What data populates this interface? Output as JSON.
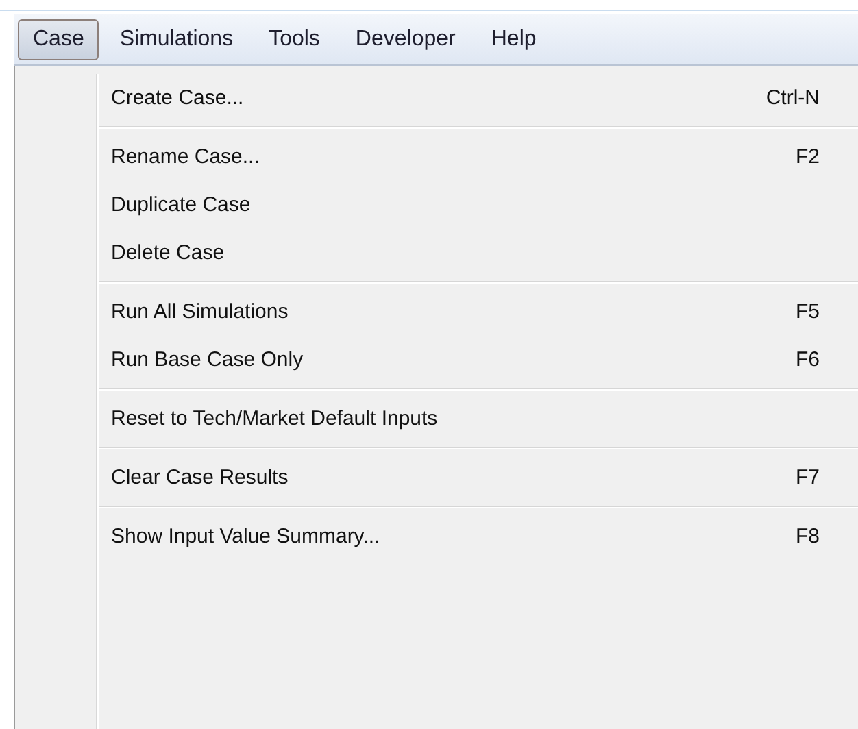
{
  "menubar": [
    {
      "label": "Case",
      "selected": true
    },
    {
      "label": "Simulations",
      "selected": false
    },
    {
      "label": "Tools",
      "selected": false
    },
    {
      "label": "Developer",
      "selected": false
    },
    {
      "label": "Help",
      "selected": false
    }
  ],
  "menu": {
    "groups": [
      [
        {
          "label": "Create Case...",
          "shortcut": "Ctrl-N"
        }
      ],
      [
        {
          "label": "Rename Case...",
          "shortcut": "F2"
        },
        {
          "label": "Duplicate Case"
        },
        {
          "label": "Delete Case"
        }
      ],
      [
        {
          "label": "Run All Simulations",
          "shortcut": "F5"
        },
        {
          "label": "Run Base Case Only",
          "shortcut": "F6"
        }
      ],
      [
        {
          "label": "Reset to Tech/Market Default Inputs"
        }
      ],
      [
        {
          "label": "Clear Case Results",
          "shortcut": "F7"
        }
      ],
      [
        {
          "label": "Show Input Value Summary...",
          "shortcut": "F8"
        }
      ]
    ]
  }
}
